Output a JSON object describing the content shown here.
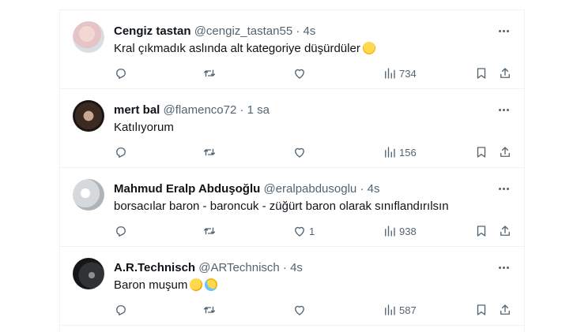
{
  "tweets": [
    {
      "name": "Cengiz tastan",
      "handle": "@cengiz_tastan55",
      "dot": "·",
      "time": "4s",
      "text": "Kral çıkmadık aslında alt kategoriye düşürdüler",
      "emojis": [
        "smiling-face"
      ],
      "likes": "",
      "views": "734"
    },
    {
      "name": "mert bal",
      "handle": "@flamenco72",
      "dot": "·",
      "time": "1 sa",
      "text": "Katılıyorum",
      "emojis": [],
      "likes": "",
      "views": "156"
    },
    {
      "name": "Mahmud Eralp Abduşoğlu",
      "handle": "@eralpabdusoglu",
      "dot": "·",
      "time": "4s",
      "text": "borsacılar baron - baroncuk - züğürt baron olarak sınıflandırılsın",
      "emojis": [],
      "likes": "1",
      "views": "938"
    },
    {
      "name": "A.R.Technisch",
      "handle": "@ARTechnisch",
      "dot": "·",
      "time": "4s",
      "text": "Baron muşum",
      "emojis": [
        "thinking-face",
        "grinning-sweat-face"
      ],
      "likes": "",
      "views": "587"
    }
  ],
  "icons": [
    "more-icon",
    "reply-icon",
    "retweet-icon",
    "like-icon",
    "views-icon",
    "bookmark-icon",
    "share-icon"
  ],
  "colors": {
    "text": "#0f1419",
    "secondary": "#536471",
    "border": "#eff3f4"
  }
}
